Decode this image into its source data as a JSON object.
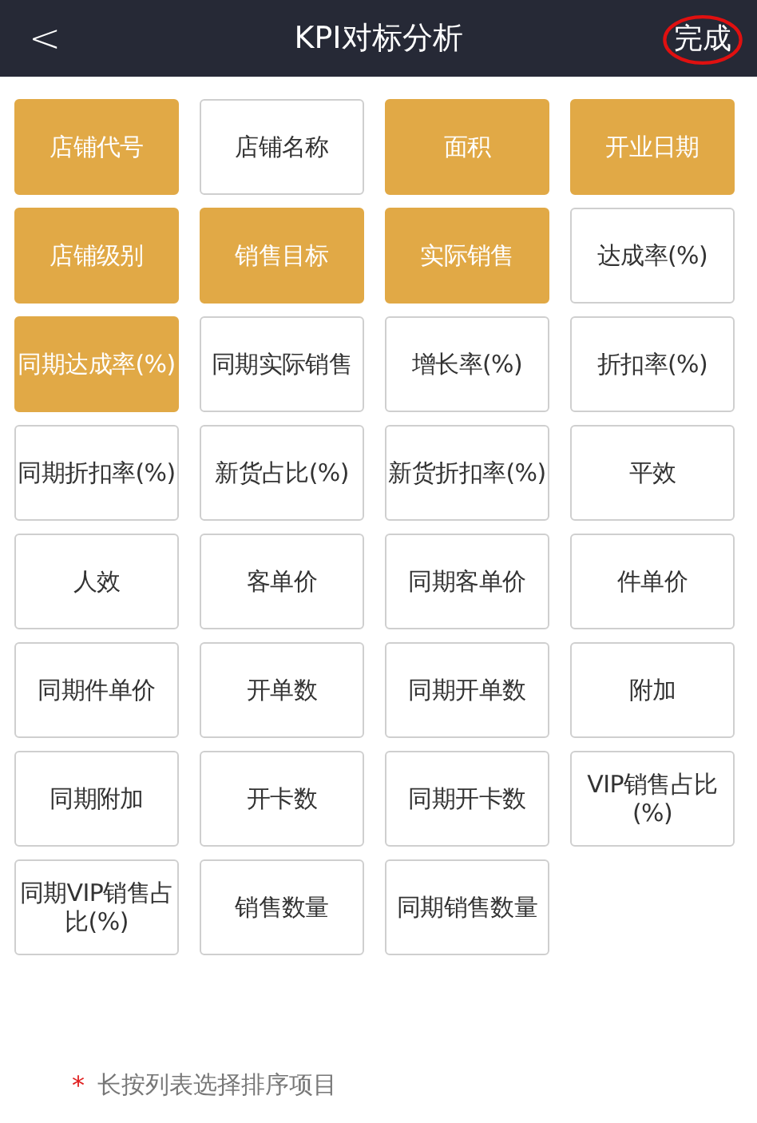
{
  "header": {
    "back": "<",
    "title": "KPI对标分析",
    "done": "完成"
  },
  "items": [
    {
      "label": "店铺代号",
      "selected": true
    },
    {
      "label": "店铺名称",
      "selected": false
    },
    {
      "label": "面积",
      "selected": true
    },
    {
      "label": "开业日期",
      "selected": true
    },
    {
      "label": "店铺级别",
      "selected": true
    },
    {
      "label": "销售目标",
      "selected": true
    },
    {
      "label": "实际销售",
      "selected": true
    },
    {
      "label": "达成率(%)",
      "selected": false
    },
    {
      "label": "同期达成率(%)",
      "selected": true
    },
    {
      "label": "同期实际销售",
      "selected": false
    },
    {
      "label": "增长率(%)",
      "selected": false
    },
    {
      "label": "折扣率(%)",
      "selected": false
    },
    {
      "label": "同期折扣率(%)",
      "selected": false
    },
    {
      "label": "新货占比(%)",
      "selected": false
    },
    {
      "label": "新货折扣率(%)",
      "selected": false
    },
    {
      "label": "平效",
      "selected": false
    },
    {
      "label": "人效",
      "selected": false
    },
    {
      "label": "客单价",
      "selected": false
    },
    {
      "label": "同期客单价",
      "selected": false
    },
    {
      "label": "件单价",
      "selected": false
    },
    {
      "label": "同期件单价",
      "selected": false
    },
    {
      "label": "开单数",
      "selected": false
    },
    {
      "label": "同期开单数",
      "selected": false
    },
    {
      "label": "附加",
      "selected": false
    },
    {
      "label": "同期附加",
      "selected": false
    },
    {
      "label": "开卡数",
      "selected": false
    },
    {
      "label": "同期开卡数",
      "selected": false
    },
    {
      "label": "VIP销售占比(%)",
      "selected": false
    },
    {
      "label": "同期VIP销售占比(%)",
      "selected": false
    },
    {
      "label": "销售数量",
      "selected": false
    },
    {
      "label": "同期销售数量",
      "selected": false
    }
  ],
  "note": {
    "mark": "*",
    "text": "长按列表选择排序项目"
  }
}
